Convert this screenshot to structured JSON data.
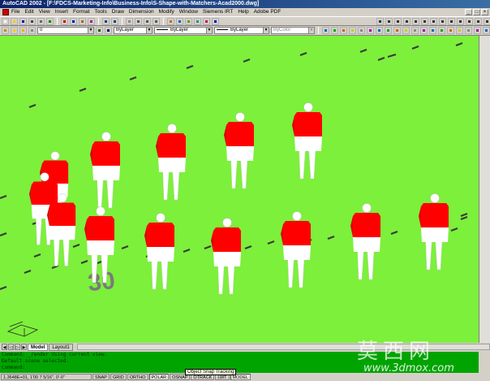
{
  "window": {
    "title": "AutoCAD 2002 - [F:\\FDCS-Marketing-Info\\Business-Info\\S-Shape-with-Matchers-Acad2000.dwg]",
    "controls": [
      "_",
      "□",
      "×"
    ]
  },
  "menu": [
    "File",
    "Edit",
    "View",
    "Insert",
    "Format",
    "Tools",
    "Draw",
    "Dimension",
    "Modify",
    "Window",
    "Siemens IRT",
    "Help",
    "Adobe PDF"
  ],
  "toolbar": {
    "layer_value": "0",
    "color_value": "ByLayer",
    "linetype_value": "ByLayer",
    "lineweight_value": "ByLayer",
    "plotstyle_value": "ByColor"
  },
  "field": {
    "yard_number": "30",
    "colors": {
      "turf": "#7cf03a",
      "jersey": "#ff0000",
      "pants": "#ffffff",
      "hash": "#3a3a3a",
      "number": "#7a7a7a"
    }
  },
  "tabs": [
    "Model",
    "Layout1"
  ],
  "command_lines": [
    "Command: _render Using current view.",
    "Default scene selected.",
    "Command:"
  ],
  "status": {
    "coords": "1.3648E+01, 1'00 7 5/16\", 0'-0\"",
    "buttons": [
      "SNAP",
      "GRID",
      "ORTHO",
      "POLAR",
      "OSNAP",
      "OTRACK",
      "LWT",
      "MODEL"
    ],
    "tooltip": "Object Snap Tracking"
  },
  "watermark": {
    "chars": "莫西网",
    "url": "www.3dmox.com"
  }
}
